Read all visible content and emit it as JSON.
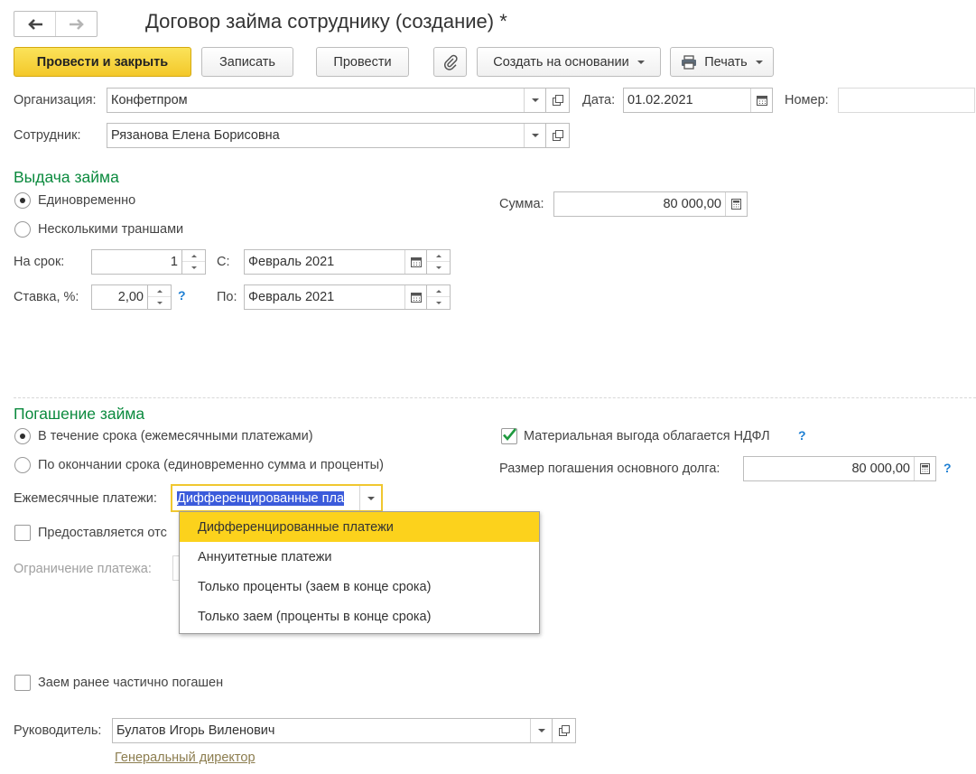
{
  "window": {
    "title": "Договор займа сотруднику (создание) *"
  },
  "nav": {
    "back_icon": "arrow-left-icon",
    "forward_icon": "arrow-right-icon"
  },
  "toolbar": {
    "post_and_close": "Провести и закрыть",
    "save": "Записать",
    "post": "Провести",
    "attach_icon": "paperclip-icon",
    "create_based_on": "Создать на основании",
    "print": "Печать",
    "print_icon": "printer-icon"
  },
  "header": {
    "organization_label": "Организация:",
    "organization_value": "Конфетпром",
    "date_label": "Дата:",
    "date_value": "01.02.2021",
    "number_label": "Номер:",
    "number_value": "",
    "employee_label": "Сотрудник:",
    "employee_value": "Рязанова Елена Борисовна"
  },
  "issue": {
    "heading": "Выдача займа",
    "option_once": "Единовременно",
    "option_tranches": "Несколькими траншами",
    "selected": "once",
    "sum_label": "Сумма:",
    "sum_value": "80 000,00",
    "term_label": "На срок:",
    "term_value": "1",
    "from_label": "С:",
    "from_value": "Февраль 2021",
    "rate_label": "Ставка, %:",
    "rate_value": "2,00",
    "to_label": "По:",
    "to_value": "Февраль 2021"
  },
  "repayment": {
    "heading": "Погашение займа",
    "option_monthly": "В течение срока (ежемесячными платежами)",
    "option_end": "По окончании срока (единовременно сумма и проценты)",
    "selected": "monthly",
    "ndfl_label": "Материальная выгода облагается НДФЛ",
    "ndfl_checked": true,
    "principal_label": "Размер погашения основного долга:",
    "principal_value": "80 000,00",
    "monthly_label": "Ежемесячные платежи:",
    "monthly_value": "Дифференцированные пла",
    "deferral_label": "Предоставляется отс",
    "limit_label": "Ограничение платежа:",
    "dropdown_options": [
      "Дифференцированные платежи",
      "Аннуитетные платежи",
      "Только проценты (заем в конце срока)",
      "Только заем (проценты в конце срока)"
    ],
    "dropdown_selected_index": 0
  },
  "partial": {
    "label": "Заем ранее частично погашен",
    "checked": false
  },
  "manager": {
    "label": "Руководитель:",
    "value": "Булатов Игорь Виленович",
    "position_link": "Генеральный директор"
  },
  "colors": {
    "accent_yellow": "#f3c82a",
    "section_green": "#0b8a3e",
    "help_blue": "#1d7fd3",
    "selection_blue": "#3b5bdb"
  }
}
